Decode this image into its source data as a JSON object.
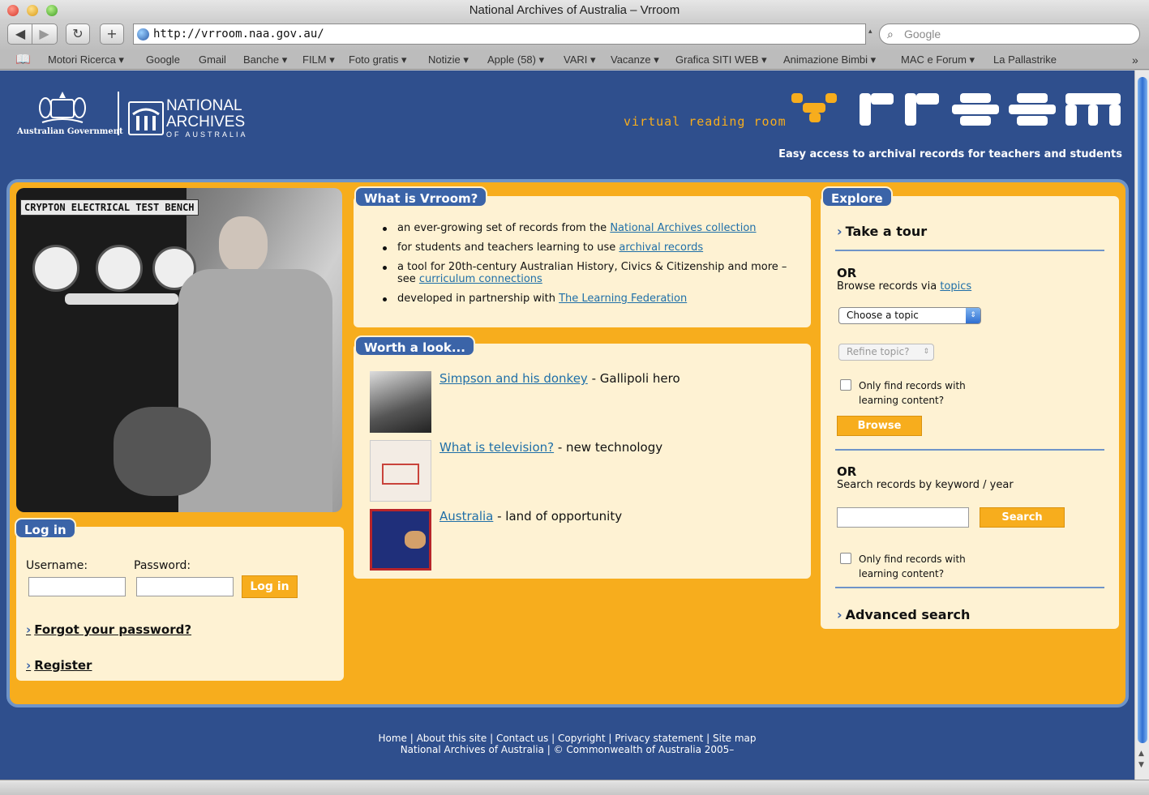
{
  "browser": {
    "window_title": "National Archives of Australia – Vrroom",
    "url": "http://vrroom.naa.gov.au/",
    "search_placeholder": "Google",
    "bookmarks": [
      "Motori Ricerca ▾",
      "Google",
      "Gmail",
      "Banche ▾",
      "FILM ▾",
      "Foto gratis ▾",
      "Notizie ▾",
      "Apple (58) ▾",
      "VARI ▾",
      "Vacanze ▾",
      "Grafica SITI WEB ▾",
      "Animazione Bimbi ▾",
      "MAC e Forum ▾",
      "La Pallastrike"
    ],
    "icons": [
      "back-icon",
      "forward-icon",
      "reload-icon",
      "add-bookmark-icon",
      "globe-icon",
      "search-icon",
      "bookmarks-book-icon",
      "overflow-chevron-icon"
    ]
  },
  "header": {
    "gov_line": "Australian Government",
    "archives_line1": "NATIONAL",
    "archives_line2": "ARCHIVES",
    "archives_line3": "OF AUSTRALIA",
    "virtual_reading_room": "virtual reading room",
    "tagline": "Easy access to archival records for teachers and students",
    "colors": {
      "page_blue": "#2f4f8d",
      "accent_orange": "#f7ad1d",
      "panel_cream": "#fef2d3",
      "tab_blue": "#3b64a8"
    }
  },
  "photo": {
    "caption": "CRYPTON  ELECTRICAL TEST BENCH"
  },
  "login": {
    "tab": "Log in",
    "username_label": "Username:",
    "password_label": "Password:",
    "button": "Log in",
    "forgot": "Forgot your password?",
    "register": "Register"
  },
  "what": {
    "tab": "What is Vrroom?",
    "items": [
      {
        "pre": "an ever-growing set of records from the ",
        "link": "National Archives collection",
        "post": ""
      },
      {
        "pre": "for students and teachers learning to use ",
        "link": "archival records",
        "post": ""
      },
      {
        "pre": "a tool for 20th-century Australian History, Civics & Citizenship and more – see ",
        "link": "curriculum connections",
        "post": ""
      },
      {
        "pre": "developed in partnership with ",
        "link": "The Learning Federation",
        "post": ""
      }
    ]
  },
  "worth": {
    "tab": "Worth a look...",
    "items": [
      {
        "link": "Simpson and his donkey",
        "desc": " - Gallipoli hero"
      },
      {
        "link": "What is television?",
        "desc": " - new technology"
      },
      {
        "link": "Australia",
        "desc": " - land of opportunity"
      }
    ]
  },
  "explore": {
    "tab": "Explore",
    "take_tour": "Take a tour",
    "or1": "OR",
    "browse_pre": "Browse records via ",
    "browse_link": "topics",
    "topic_select": "Choose a topic",
    "refine_select": "Refine topic?",
    "only_learning": "Only find records with learning content?",
    "browse_button": "Browse",
    "or2": "OR",
    "search_label": "Search records by keyword / year",
    "search_button": "Search",
    "only_learning2": "Only find records with learning content?",
    "advanced": "Advanced search"
  },
  "footer": {
    "links": [
      "Home",
      "About this site",
      "Contact us",
      "Copyright",
      "Privacy statement",
      "Site map"
    ],
    "copyright": "National Archives of Australia | © Commonwealth of Australia 2005–"
  }
}
